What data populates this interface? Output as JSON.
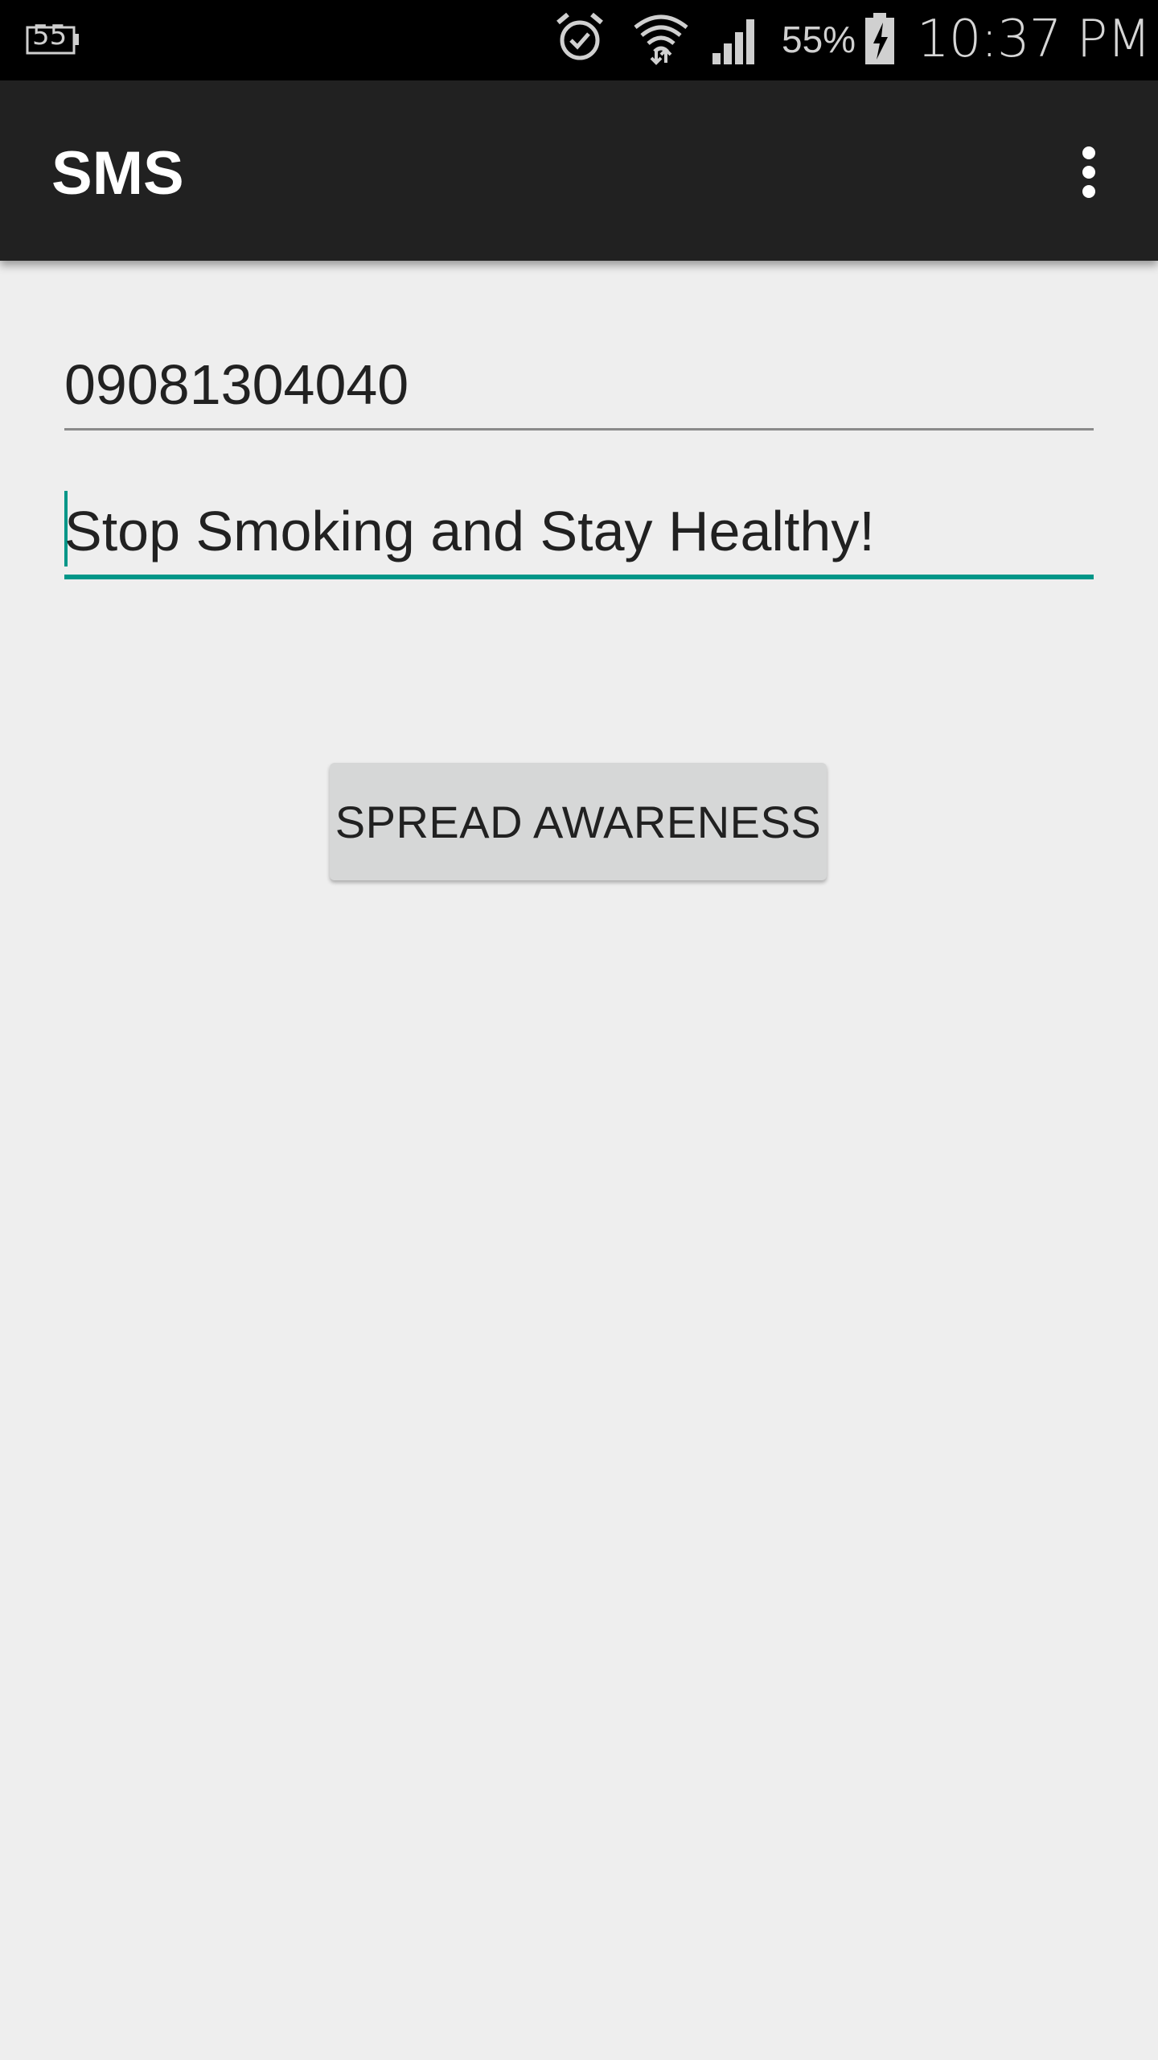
{
  "status_bar": {
    "notification_count": "55",
    "battery_percent": "55%",
    "time": "10:37 PM",
    "icons": [
      "notification-icon",
      "alarm-icon",
      "wifi-icon",
      "signal-icon",
      "battery-charging-icon"
    ]
  },
  "app_bar": {
    "title": "SMS",
    "menu_icon": "overflow-menu-icon"
  },
  "form": {
    "phone_number": "09081304040",
    "message": "Stop Smoking and Stay Healthy!",
    "button_label": "SPREAD AWARENESS"
  },
  "colors": {
    "accent": "#009688",
    "app_bar": "#212121",
    "background": "#eeeeee",
    "button": "#d6d7d7"
  }
}
